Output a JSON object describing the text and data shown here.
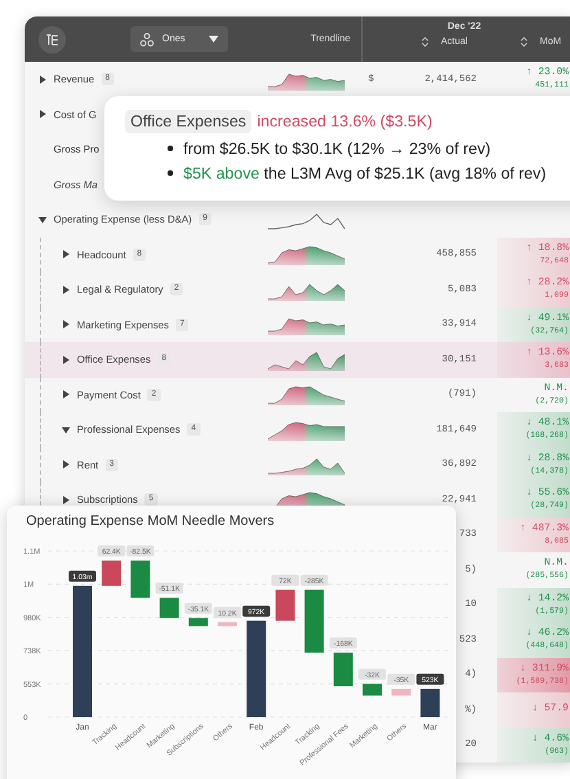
{
  "header": {
    "view": "Ones",
    "trend_heading": "Trendline",
    "period": "Dec '22",
    "columns": [
      "Actual",
      "MoM"
    ]
  },
  "rows": [
    {
      "kind": "group",
      "label": "Revenue",
      "count": "8",
      "expanded": false,
      "selected": false,
      "currency": "$",
      "actual": "2,414,562",
      "mom": {
        "change": "↑ 23.0%",
        "amount": "451,111",
        "color": "#22914b",
        "shaded": false
      }
    },
    {
      "kind": "group",
      "label": "Cost of G",
      "expanded": false,
      "selected": false
    },
    {
      "kind": "total",
      "label": "Gross Pro",
      "selected": false
    },
    {
      "kind": "ratio",
      "label": "Gross Ma",
      "selected": false
    },
    {
      "kind": "group",
      "label": "Operating Expense (less D&A)",
      "count": "9",
      "expanded": true,
      "selected": false,
      "children": [
        {
          "kind": "group",
          "label": "Headcount",
          "count": "8",
          "expanded": false,
          "selected": false,
          "actual": "458,855",
          "mom": {
            "change": "↑ 18.8%",
            "amount": "72,648",
            "color": "#d24a62",
            "shaded": true,
            "strong": false
          }
        },
        {
          "kind": "group",
          "label": "Legal & Regulatory",
          "count": "2",
          "expanded": false,
          "selected": false,
          "actual": "5,083",
          "mom": {
            "change": "↑ 28.2%",
            "amount": "1,099",
            "color": "#d24a62",
            "shaded": true,
            "strong": false
          }
        },
        {
          "kind": "group",
          "label": "Marketing Expenses",
          "count": "7",
          "expanded": false,
          "selected": false,
          "actual": "33,914",
          "mom": {
            "change": "↓ 49.1%",
            "amount": "(32,764)",
            "color": "#22914b",
            "shaded": true,
            "strong": false
          }
        },
        {
          "kind": "group",
          "label": "Office Expenses",
          "count": "8",
          "expanded": false,
          "selected": true,
          "actual": "30,151",
          "mom": {
            "change": "↑ 13.6%",
            "amount": "3,683",
            "color": "#d24a62",
            "shaded": true,
            "strong": false
          }
        },
        {
          "kind": "group",
          "label": "Payment Cost",
          "count": "2",
          "expanded": false,
          "selected": false,
          "actual": "(791)",
          "mom": {
            "change": "N.M.",
            "amount": "(2,720)",
            "color": "#22914b",
            "shaded": false
          }
        },
        {
          "kind": "group",
          "label": "Professional Expenses",
          "count": "4",
          "expanded": true,
          "selected": false,
          "actual": "181,649",
          "mom": {
            "change": "↓ 48.1%",
            "amount": "(168,268)",
            "color": "#22914b",
            "shaded": true,
            "strong": false
          }
        },
        {
          "kind": "group",
          "label": "Rent",
          "count": "3",
          "expanded": false,
          "selected": false,
          "actual": "36,892",
          "mom": {
            "change": "↓ 28.8%",
            "amount": "(14,378)",
            "color": "#22914b",
            "shaded": true,
            "strong": false
          }
        },
        {
          "kind": "group",
          "label": "Subscriptions",
          "count": "5",
          "expanded": false,
          "selected": false,
          "actual": "22,941",
          "mom": {
            "change": "↓ 55.6%",
            "amount": "(28,749)",
            "color": "#22914b",
            "shaded": true,
            "strong": false
          }
        },
        {
          "selected": false,
          "actual": "733",
          "mom": {
            "change": "↑ 487.3%",
            "amount": "8,085",
            "color": "#d24a62",
            "shaded": true,
            "strong": false
          }
        },
        {
          "selected": false,
          "actual": "5)",
          "mom": {
            "change": "N.M.",
            "amount": "(285,556)",
            "color": "#22914b",
            "shaded": false
          }
        },
        {
          "selected": false,
          "actual": "10",
          "mom": {
            "change": "↓ 14.2%",
            "amount": "(1,579)",
            "color": "#22914b",
            "shaded": true,
            "strong": false
          }
        },
        {
          "selected": false,
          "actual": "523",
          "mom": {
            "change": "↓ 46.2%",
            "amount": "(448,648)",
            "color": "#22914b",
            "shaded": true,
            "strong": false
          }
        },
        {
          "selected": false,
          "actual": "4)",
          "mom": {
            "change": "↓ 311.9%",
            "amount": "(1,589,738)",
            "color": "#d24a62",
            "shaded": true,
            "strong": true
          }
        },
        {
          "selected": false,
          "actual": "%)",
          "mom": {
            "change": "↓ 57.9",
            "color": "#d24a62",
            "shaded": true,
            "strong": false
          }
        },
        {
          "selected": false,
          "actual": "20",
          "mom": {
            "change": "↓ 4.6%",
            "amount": "(963)",
            "color": "#22914b",
            "shaded": true,
            "strong": false
          }
        }
      ]
    }
  ],
  "insight": {
    "subject": "Office Expenses",
    "change": "increased 13.6% ($3.5K)",
    "bullets": [
      {
        "text": "from $26.5K to $30.1K (12% → 23% of rev)"
      },
      {
        "lead": "$5K above",
        "text": " the L3M Avg of $25.1K (avg 18% of rev)"
      }
    ]
  },
  "chart_card": {
    "title": "Operating Expense MoM Needle Movers",
    "y_labels": [
      "1.1M",
      "1M",
      "980K",
      "738K",
      "553K",
      "0"
    ],
    "bars": [
      {
        "category": "Jan",
        "value_label": "1.03m",
        "kind": "total"
      },
      {
        "category": "Tracking",
        "value_label": "62.4K",
        "kind": "increase"
      },
      {
        "category": "Headcount",
        "value_label": "-82.5K",
        "kind": "decrease"
      },
      {
        "category": "Marketing",
        "value_label": "-51.1K",
        "kind": "decrease"
      },
      {
        "category": "Subscriptions",
        "value_label": "-35.1K",
        "kind": "decrease"
      },
      {
        "category": "Others",
        "value_label": "10.2K",
        "kind": "other"
      },
      {
        "category": "Feb",
        "value_label": "972K",
        "kind": "total"
      },
      {
        "category": "Headcount",
        "value_label": "72K",
        "kind": "increase"
      },
      {
        "category": "Tracking",
        "value_label": "-285K",
        "kind": "decrease"
      },
      {
        "category": "Professional Fees",
        "value_label": "-168K",
        "kind": "decrease"
      },
      {
        "category": "Marketing",
        "value_label": "-32K",
        "kind": "decrease"
      },
      {
        "category": "Others",
        "value_label": "-35K",
        "kind": "other"
      },
      {
        "category": "Mar",
        "value_label": "523K",
        "kind": "total"
      }
    ]
  }
}
